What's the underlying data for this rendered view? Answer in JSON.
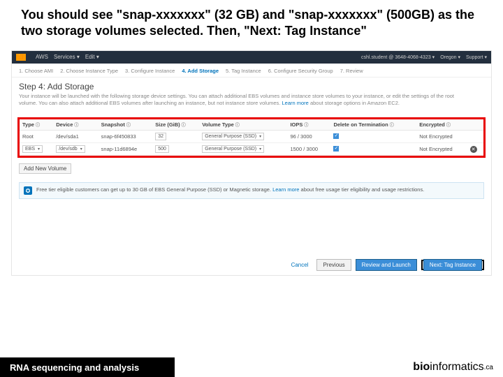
{
  "slide": {
    "title": "You should see \"snap-xxxxxxx\" (32 GB) and \"snap-xxxxxxx\" (500GB) as the two storage volumes selected. Then, \"Next: Tag Instance\""
  },
  "topbar": {
    "aws": "AWS",
    "services": "Services ▾",
    "edit": "Edit ▾",
    "user": "cshl.student @ 3648-4068-4323 ▾",
    "region": "Oregon ▾",
    "support": "Support ▾"
  },
  "wizard": {
    "s1": "1. Choose AMI",
    "s2": "2. Choose Instance Type",
    "s3": "3. Configure Instance",
    "s4": "4. Add Storage",
    "s5": "5. Tag Instance",
    "s6": "6. Configure Security Group",
    "s7": "7. Review"
  },
  "step": {
    "title": "Step 4: Add Storage",
    "desc1": "Your instance will be launched with the following storage device settings. You can attach additional EBS volumes and instance store volumes to your instance, or edit the settings of the root volume. You can also attach additional EBS volumes after launching an instance, but not instance store volumes.",
    "learn": "Learn more",
    "desc2": "about storage options in Amazon EC2."
  },
  "table": {
    "head": {
      "type": "Type",
      "device": "Device",
      "snapshot": "Snapshot",
      "size": "Size (GiB)",
      "voltype": "Volume Type",
      "iops": "IOPS",
      "delete": "Delete on Termination",
      "enc": "Encrypted"
    },
    "r1": {
      "type": "Root",
      "device": "/dev/sda1",
      "snapshot": "snap-6f450833",
      "size": "32",
      "voltype": "General Purpose (SSD)",
      "iops": "96 / 3000",
      "enc": "Not Encrypted"
    },
    "r2": {
      "type": "EBS",
      "device": "/dev/sdb",
      "snapshot": "snap-11d6894e",
      "size": "500",
      "voltype": "General Purpose (SSD)",
      "iops": "1500 / 3000",
      "enc": "Not Encrypted"
    }
  },
  "addvol": "Add New Volume",
  "info": {
    "text1": "Free tier eligible customers can get up to 30 GB of EBS General Purpose (SSD) or Magnetic storage.",
    "learn": "Learn more",
    "text2": "about free usage tier eligibility and usage restrictions."
  },
  "buttons": {
    "cancel": "Cancel",
    "previous": "Previous",
    "review": "Review and Launch",
    "next": "Next: Tag Instance"
  },
  "footer": {
    "left": "RNA sequencing and analysis",
    "brand_bold": "bio",
    "brand_rest": "informatics",
    "tld": ".ca"
  }
}
